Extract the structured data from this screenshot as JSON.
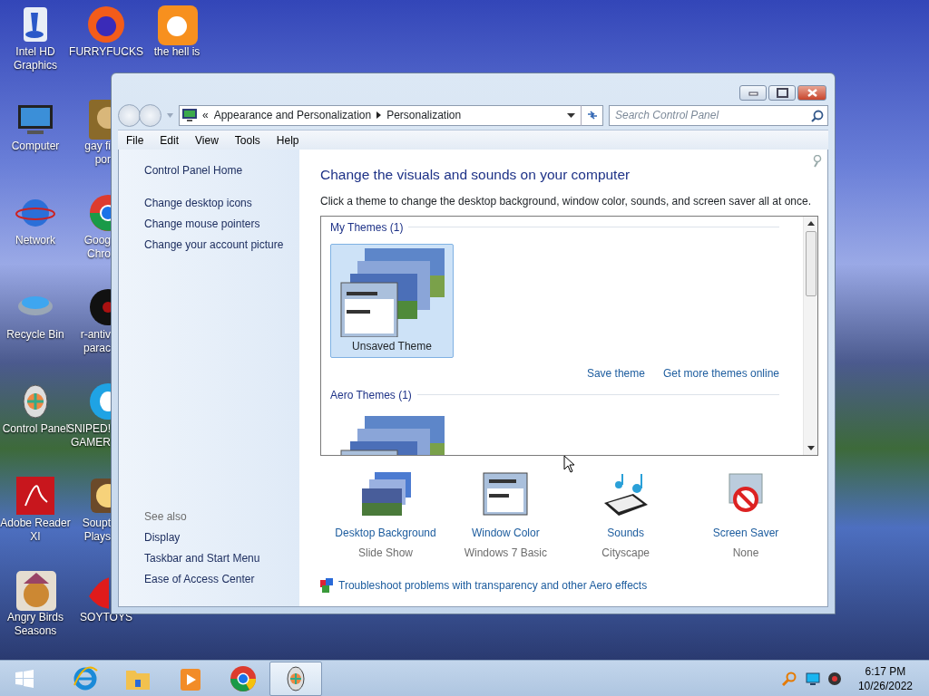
{
  "desktop_icons": [
    {
      "label": "Intel HD\nGraphics"
    },
    {
      "label": "Computer"
    },
    {
      "label": "Network"
    },
    {
      "label": "Recycle Bin"
    },
    {
      "label": "Control Panel"
    },
    {
      "label": "Adobe Reader\nXI"
    },
    {
      "label": "Angry Birds\nSeasons"
    },
    {
      "label": "FURRYFUCKS"
    },
    {
      "label": "gay fi\npor"
    },
    {
      "label": "Goog\nChro"
    },
    {
      "label": "r-antiv\nparac"
    },
    {
      "label": "SNIPED!\nGAMER"
    },
    {
      "label": "Soupt\nPlays"
    },
    {
      "label": "SOYTOYS"
    },
    {
      "label": "the hell is"
    }
  ],
  "window": {
    "address": {
      "overflow": "«",
      "path": [
        "Appearance and Personalization",
        "Personalization"
      ]
    },
    "search": {
      "placeholder": "Search Control Panel"
    },
    "menu": [
      "File",
      "Edit",
      "View",
      "Tools",
      "Help"
    ],
    "sidebar": {
      "home": "Control Panel Home",
      "tasks": [
        "Change desktop icons",
        "Change mouse pointers",
        "Change your account picture"
      ],
      "see_also_title": "See also",
      "see_also": [
        "Display",
        "Taskbar and Start Menu",
        "Ease of Access Center"
      ]
    },
    "heading": "Change the visuals and sounds on your computer",
    "description": "Click a theme to change the desktop background, window color, sounds, and screen saver all at once.",
    "theme_groups": [
      {
        "title": "My Themes (1)",
        "themes": [
          {
            "label": "Unsaved Theme",
            "selected": true
          }
        ],
        "links": [
          "Save theme",
          "Get more themes online"
        ]
      },
      {
        "title": "Aero Themes (1)",
        "themes": [
          {
            "selected": false
          }
        ]
      }
    ],
    "settings": [
      {
        "kind": "background",
        "title": "Desktop Background",
        "value": "Slide Show"
      },
      {
        "kind": "color",
        "title": "Window Color",
        "value": "Windows 7 Basic"
      },
      {
        "kind": "sounds",
        "title": "Sounds",
        "value": "Cityscape"
      },
      {
        "kind": "saver",
        "title": "Screen Saver",
        "value": "None"
      }
    ],
    "troubleshoot": "Troubleshoot problems with transparency and other Aero effects"
  },
  "taskbar": {
    "items": [
      {
        "kind": "ie",
        "selected": false
      },
      {
        "kind": "folder",
        "selected": false
      },
      {
        "kind": "media",
        "selected": false
      },
      {
        "kind": "chrome",
        "selected": false
      },
      {
        "kind": "control",
        "selected": true
      }
    ],
    "time": "6:17 PM",
    "date": "10/26/2022"
  }
}
